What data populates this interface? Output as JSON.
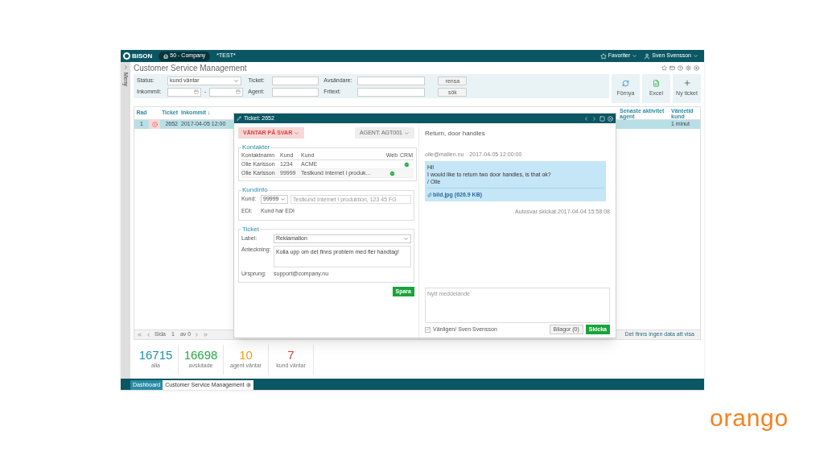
{
  "app": {
    "logo": "BISON",
    "company": "50 - Company",
    "environment": "*TEST*",
    "favorites": "Favoriter",
    "user": "Sven Svensson",
    "sidebar_label": "Meny",
    "title": "Customer Service Management"
  },
  "filters": {
    "status_label": "Status:",
    "status_value": "kund väntar",
    "incoming_label": "Inkommit:",
    "date_separator": "-",
    "ticket_label": "Ticket:",
    "agent_label": "Agent:",
    "sender_label": "Avsändare:",
    "freetext_label": "Fritext:",
    "buttons": [
      "rensa",
      "sök"
    ]
  },
  "actions": [
    {
      "label": "Förnya",
      "kind": "refresh"
    },
    {
      "label": "Excel",
      "kind": "excel"
    },
    {
      "label": "Ny ticket",
      "kind": "add"
    }
  ],
  "table": {
    "left_columns": [
      "Rad",
      "Ticket",
      "Inkommit ↓"
    ],
    "right_columns": [
      "Senaste aktivitet agent",
      "Väntetid kund"
    ],
    "rows": [
      {
        "number": "1",
        "alert": true,
        "ticket": "2652",
        "incoming": "2017-04-05 12:00",
        "wait": "1 minut",
        "selected": true
      }
    ]
  },
  "pager": {
    "page_label": "Sida",
    "page": "1",
    "of": "av 0",
    "empty_text": "Det finns ingen data att visa"
  },
  "stats": [
    {
      "value": "16715",
      "label": "alla",
      "color": "#1a8fa8"
    },
    {
      "value": "16698",
      "label": "avslutade",
      "color": "#2aa845"
    },
    {
      "value": "10",
      "label": "agent väntar",
      "color": "#f29b13"
    },
    {
      "value": "7",
      "label": "kund väntar",
      "color": "#d7423b"
    }
  ],
  "tabs": [
    {
      "label": "Dashboard",
      "selected": false
    },
    {
      "label": "Customer Service Management",
      "selected": true
    }
  ],
  "dialog": {
    "title": "Ticket: 2652",
    "status": "VÄNTAR PÅ SVAR",
    "agent": "AGENT: AGT001",
    "contacts": {
      "legend": "Kontakter",
      "columns": [
        "Kontaktnamn",
        "Kund",
        "Kund",
        "Web",
        "CRM"
      ],
      "rows": [
        {
          "name": "Olle Karlsson",
          "customer_no": "1234",
          "customer": "ACME",
          "web": false,
          "crm": true
        },
        {
          "name": "Olle Karlsson",
          "customer_no": "99999",
          "customer": "Testkund Internet i produk...",
          "web": true,
          "crm": false
        }
      ]
    },
    "customer_info": {
      "legend": "Kundinfo",
      "customer_label": "Kund:",
      "customer_no": "99999",
      "customer_placeholder": "Testkund Internet i produktion, 123 45 FG",
      "edi_label": "EDI:",
      "edi_value": "Kund har EDI"
    },
    "ticket": {
      "legend": "Ticket",
      "label_label": "Label:",
      "label_value": "Reklamation",
      "note_label": "Anteckning:",
      "note_value": "Kolla upp om det finns problem med fler handtag!",
      "origin_label": "Ursprung:",
      "origin_value": "support@company.nu"
    },
    "save": "Spara",
    "subject": "Return, door handles",
    "message": {
      "from": "olle@mailen.nu",
      "time": "2017-04-05 12:00:00",
      "lines": [
        "Hi!",
        "I would like to return two door handles, is that ok?",
        "/ Olle"
      ],
      "attachment": "bild.jpg (626.9 KB)"
    },
    "autoreply": "Autosvar skickat 2017-04-04 15:58:08",
    "reply_placeholder": "Nytt meddelande",
    "signature": {
      "label": "Vänligen/ Sven Svensson",
      "checked": true
    },
    "attachments_button": "Bilagor (0)",
    "send": "Skicka"
  },
  "brand": "orango"
}
